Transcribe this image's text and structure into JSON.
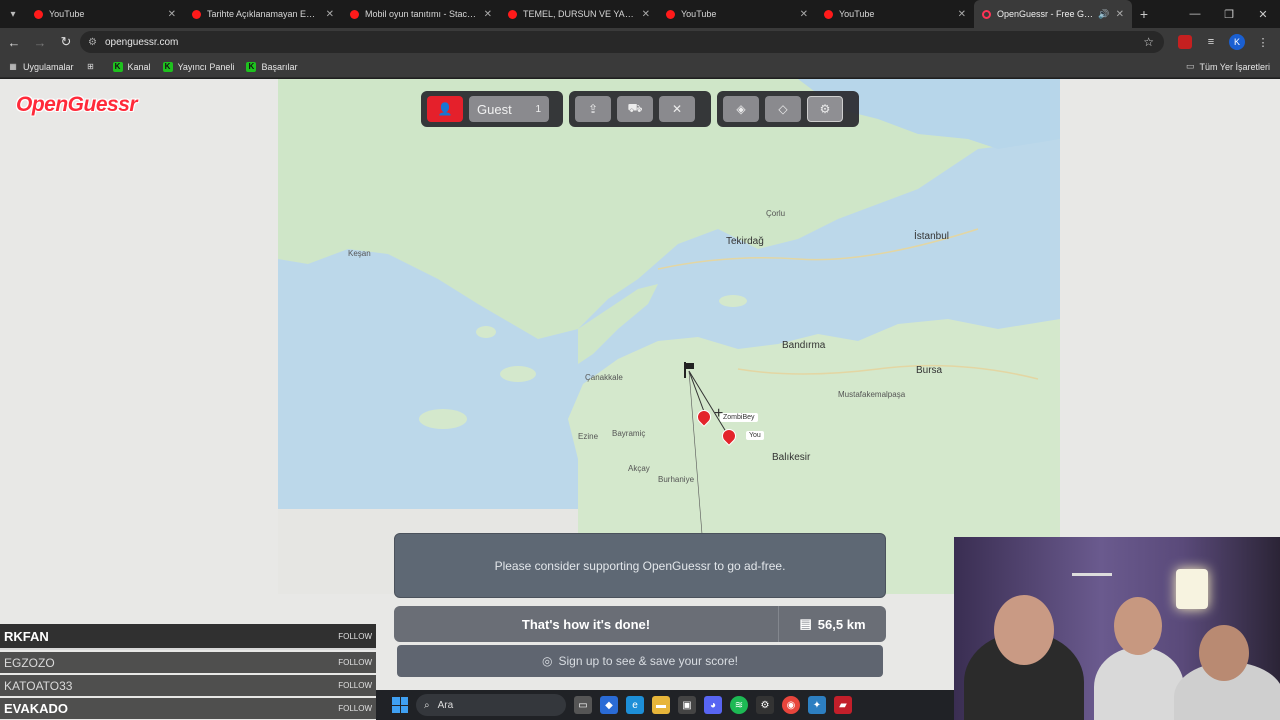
{
  "browser": {
    "tabs": [
      {
        "title": "YouTube",
        "active": false
      },
      {
        "title": "Tarihte Açıklanamayan En Şaşırt",
        "active": false
      },
      {
        "title": "Mobil oyun tanıtımı - Stack - Y",
        "active": false
      },
      {
        "title": "TEMEL, DURSUN VE YAMYAML",
        "active": false
      },
      {
        "title": "YouTube",
        "active": false
      },
      {
        "title": "YouTube",
        "active": false
      },
      {
        "title": "OpenGuessr - Free GeoGu",
        "active": true
      }
    ],
    "url": "openguessr.com",
    "profile_initial": "K",
    "bookmarks": [
      {
        "label": "Uygulamalar"
      },
      {
        "label": "Kanal"
      },
      {
        "label": "Yayıncı Paneli"
      },
      {
        "label": "Başarılar"
      }
    ],
    "all_bookmarks_label": "Tüm Yer İşaretleri"
  },
  "app": {
    "logo": "OpenGuessr",
    "user_label": "Guest",
    "user_count": "1",
    "icons": {
      "user": "user-icon",
      "upload": "upload-icon",
      "car": "car-icon",
      "swords": "swords-icon",
      "layers": "layers-icon",
      "layers_alt": "layers-outline-icon",
      "settings": "gear-icon"
    },
    "colors": {
      "accent": "#e5202b",
      "panel": "#6a6e76"
    }
  },
  "map": {
    "labels": [
      {
        "text": "İstanbul",
        "kind": "city"
      },
      {
        "text": "Tekirdağ",
        "kind": "city"
      },
      {
        "text": "Çorlu",
        "kind": "town"
      },
      {
        "text": "Bandırma",
        "kind": "city"
      },
      {
        "text": "Bursa",
        "kind": "city"
      },
      {
        "text": "Çanakkale",
        "kind": "town"
      },
      {
        "text": "Balıkesir",
        "kind": "city"
      },
      {
        "text": "Bayramiç",
        "kind": "town"
      },
      {
        "text": "Ezine",
        "kind": "town"
      },
      {
        "text": "Akçay",
        "kind": "town"
      },
      {
        "text": "Burhaniye",
        "kind": "town"
      },
      {
        "text": "Keşan",
        "kind": "town"
      },
      {
        "text": "Mustafakemalpaşa",
        "kind": "town"
      }
    ],
    "markers": {
      "guess_label": "ZombiBey",
      "you_label": "You"
    }
  },
  "result": {
    "ad_message": "Please consider supporting OpenGuessr to go ad-free.",
    "done_label": "That's how it's done!",
    "distance": "56,5 km",
    "signup_label": "Sign up to see & save your score!"
  },
  "stream": {
    "followers": [
      {
        "name": "RKFAN",
        "tag": "FOLLOW"
      },
      {
        "name": "EGZOZO",
        "tag": "FOLLOW"
      },
      {
        "name": "KATOATO33",
        "tag": "FOLLOW"
      },
      {
        "name": "EVAKADO",
        "tag": "FOLLOW"
      }
    ]
  },
  "taskbar": {
    "search_placeholder": "Ara"
  }
}
